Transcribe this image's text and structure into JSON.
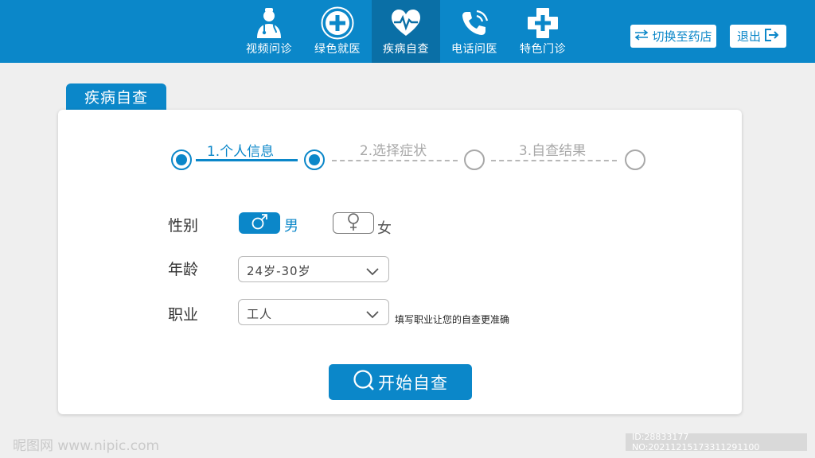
{
  "nav": {
    "items": [
      {
        "label": "视频问诊",
        "icon": "doctor-icon",
        "active": false
      },
      {
        "label": "绿色就医",
        "icon": "medical-cross-icon",
        "active": false
      },
      {
        "label": "疾病自查",
        "icon": "heart-pulse-icon",
        "active": true
      },
      {
        "label": "电话问医",
        "icon": "phone-icon",
        "active": false
      },
      {
        "label": "特色门诊",
        "icon": "clinic-cross-icon",
        "active": false
      }
    ],
    "switch_label": "切换至药店",
    "exit_label": "退出"
  },
  "section_title": "疾病自查",
  "steps": [
    {
      "label": "1.个人信息",
      "state": "done"
    },
    {
      "label": "2.选择症状",
      "state": "pending"
    },
    {
      "label": "3.自查结果",
      "state": "pending"
    }
  ],
  "form": {
    "gender_label": "性别",
    "gender_male": "男",
    "gender_female": "女",
    "gender_selected": "male",
    "age_label": "年龄",
    "age_value": "24岁-30岁",
    "job_label": "职业",
    "job_value": "工人",
    "job_hint": "填写职业让您的自查更准确",
    "start_button": "开始自查"
  },
  "watermark": {
    "left": "昵图网 www.nipic.com",
    "right": "ID:28833177 NO:20211215173311291100"
  },
  "colors": {
    "accent": "#0b87c9",
    "accent_dark": "#0a6fa6",
    "inactive": "#a8a8a8"
  }
}
